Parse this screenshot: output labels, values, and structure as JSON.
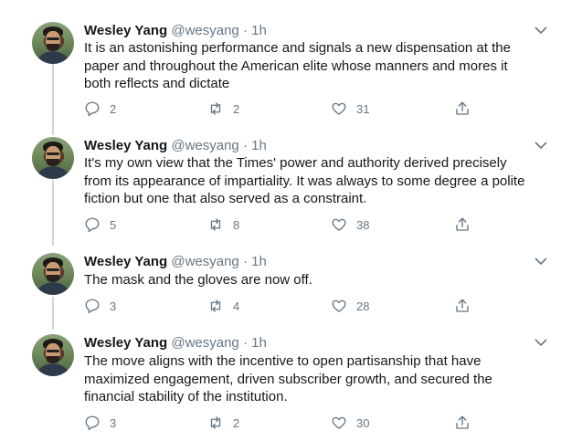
{
  "tweets": [
    {
      "name": "Wesley Yang",
      "handle": "@wesyang",
      "separator": "·",
      "time": "1h",
      "lines": [
        "It is an astonishing performance and signals a new dispensation at the",
        "paper and throughout the American elite whose manners and mores it",
        "both reflects and dictate"
      ],
      "replies": "2",
      "retweets": "2",
      "likes": "31"
    },
    {
      "name": "Wesley Yang",
      "handle": "@wesyang",
      "separator": "·",
      "time": "1h",
      "lines": [
        "It's my own view that the Times' power and authority derived precisely",
        "from its appearance of impartiality. It was always to some degree a polite",
        "fiction but one that also served as a constraint."
      ],
      "replies": "5",
      "retweets": "8",
      "likes": "38"
    },
    {
      "name": "Wesley Yang",
      "handle": "@wesyang",
      "separator": "·",
      "time": "1h",
      "lines": [
        "The mask and the gloves are now off."
      ],
      "replies": "3",
      "retweets": "4",
      "likes": "28"
    },
    {
      "name": "Wesley Yang",
      "handle": "@wesyang",
      "separator": "·",
      "time": "1h",
      "lines": [
        "The move aligns with the incentive to open partisanship that have",
        "maximized engagement, driven subscriber growth, and secured the",
        "financial stability of the institution."
      ],
      "replies": "3",
      "retweets": "2",
      "likes": "30"
    }
  ],
  "icons": {
    "reply": "reply-icon",
    "retweet": "retweet-icon",
    "like": "like-icon",
    "share": "share-icon",
    "more": "chevron-down-icon"
  },
  "colors": {
    "text": "#14171a",
    "secondary": "#657786",
    "thread_line": "#ccd6dd"
  }
}
